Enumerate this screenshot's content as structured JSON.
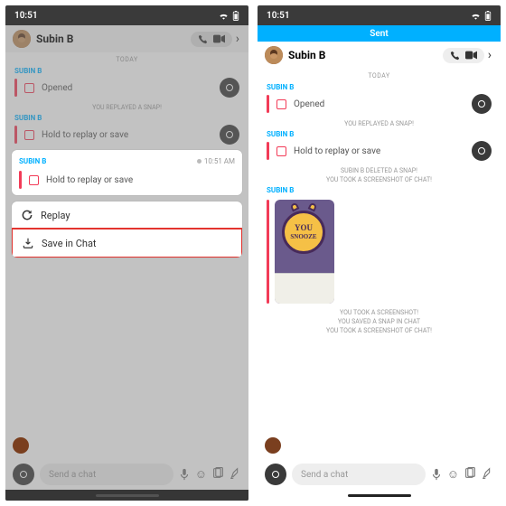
{
  "time": "10:51",
  "contact_name": "Subin B",
  "sent_banner": "Sent",
  "date_label": "TODAY",
  "sender_label": "SUBIN B",
  "msg_opened": "Opened",
  "msg_hold": "Hold to replay or save",
  "sys_replayed": "YOU REPLAYED A SNAP!",
  "sys_deleted": "SUBIN B DELETED A SNAP!",
  "sys_took_screenshot": "YOU TOOK A SCREENSHOT OF CHAT!",
  "sys_saved_snap": "YOU SAVED A SNAP IN CHAT",
  "sys_took_screenshot2": "YOU TOOK A SCREENSHOT!",
  "popup_time": "10:51 AM",
  "action_replay": "Replay",
  "action_save": "Save in Chat",
  "snooze_line1": "YOU",
  "snooze_line2": "SNOOZE",
  "chat_placeholder": "Send a chat"
}
